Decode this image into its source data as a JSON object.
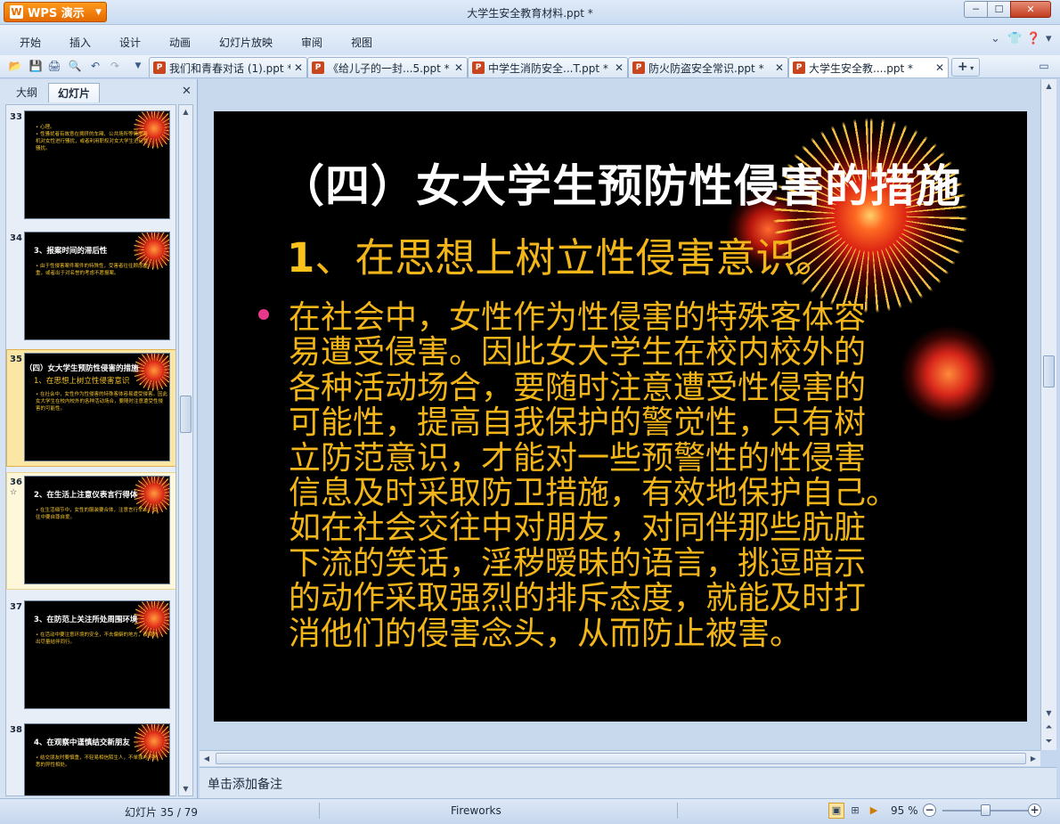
{
  "app": {
    "wps_label": "WPS 演示",
    "window_title": "大学生安全教育材料.ppt *"
  },
  "window_controls": {
    "minimize": "─",
    "maximize": "☐",
    "close": "✕"
  },
  "menu": {
    "items": [
      "开始",
      "插入",
      "设计",
      "动画",
      "幻灯片放映",
      "审阅",
      "视图"
    ]
  },
  "tabs": [
    {
      "label": "我们和青春对话 (1).ppt *",
      "close": "✕"
    },
    {
      "label": "《给儿子的一封...5.ppt *",
      "close": "✕"
    },
    {
      "label": "中学生消防安全...T.ppt *",
      "close": "✕"
    },
    {
      "label": "防火防盗安全常识.ppt *",
      "close": "✕"
    },
    {
      "label": "大学生安全教....ppt *",
      "close": "✕"
    }
  ],
  "left_panel": {
    "tab_outline": "大纲",
    "tab_slides": "幻灯片",
    "close": "✕",
    "thumbnails": [
      {
        "num": "33",
        "title": "",
        "body": "• 心理。\n• 性骚扰者有故意在拥挤的车厢、公共场所等情况乘机对女性进行骚扰，或者利用职权对女大学生进行性骚扰。"
      },
      {
        "num": "34",
        "title": "3、报案时间的滞后性",
        "body": "• 由于性侵害案件案件的特殊性，受害者往往顾虑重重，或者出于对名誉的考虑不愿报案。"
      },
      {
        "num": "35",
        "title": "（四）女大学生预防性侵害的措施",
        "subtitle": "1、在思想上树立性侵害意识",
        "body": "• 在社会中，女性作为性侵害的特殊客体容易遭受侵害。因此女大学生在校内校外的各种活动场合，要随时注意遭受性侵害的可能性。"
      },
      {
        "num": "36",
        "title": "2、在生活上注意仪表言行得体",
        "body": "• 在生活细节中，女性的服装要合体，注意言行举止，交往中要自尊自爱。"
      },
      {
        "num": "37",
        "title": "3、在防范上关注所处周围环境",
        "body": "• 在活动中要注意环境的安全，不去偏僻的地方，夜间外出尽量结伴同行。"
      },
      {
        "num": "38",
        "title": "4、在观察中谨慎结交新朋友",
        "body": "• 结交朋友时要慎重，不轻易相信陌生人，不单独与不熟悉的异性相处。"
      }
    ]
  },
  "slide": {
    "title": "（四）女大学生预防性侵害的措施",
    "subtitle_num": "1",
    "subtitle_text": "、在思想上树立性侵害意识。",
    "body_lines": [
      "在社会中，女性作为性侵害的特殊客体容",
      "易遭受侵害。因此女大学生在校内校外的",
      "各种活动场合，要随时注意遭受性侵害的",
      "可能性，提高自我保护的警觉性，只有树",
      "立防范意识，才能对一些预警性的性侵害",
      "信息及时采取防卫措施，有效地保护自己。",
      "如在社会交往中对朋友，对同伴那些肮脏",
      "下流的笑话，淫秽暧昧的语言，挑逗暗示",
      "的动作采取强烈的排斥态度，就能及时打",
      "消他们的侵害念头，从而防止被害。"
    ]
  },
  "notes_placeholder": "单击添加备注",
  "status": {
    "slides_label": "幻灯片 35 / 79",
    "theme": "Fireworks",
    "zoom": "95 %",
    "zoom_level": 0.5
  }
}
